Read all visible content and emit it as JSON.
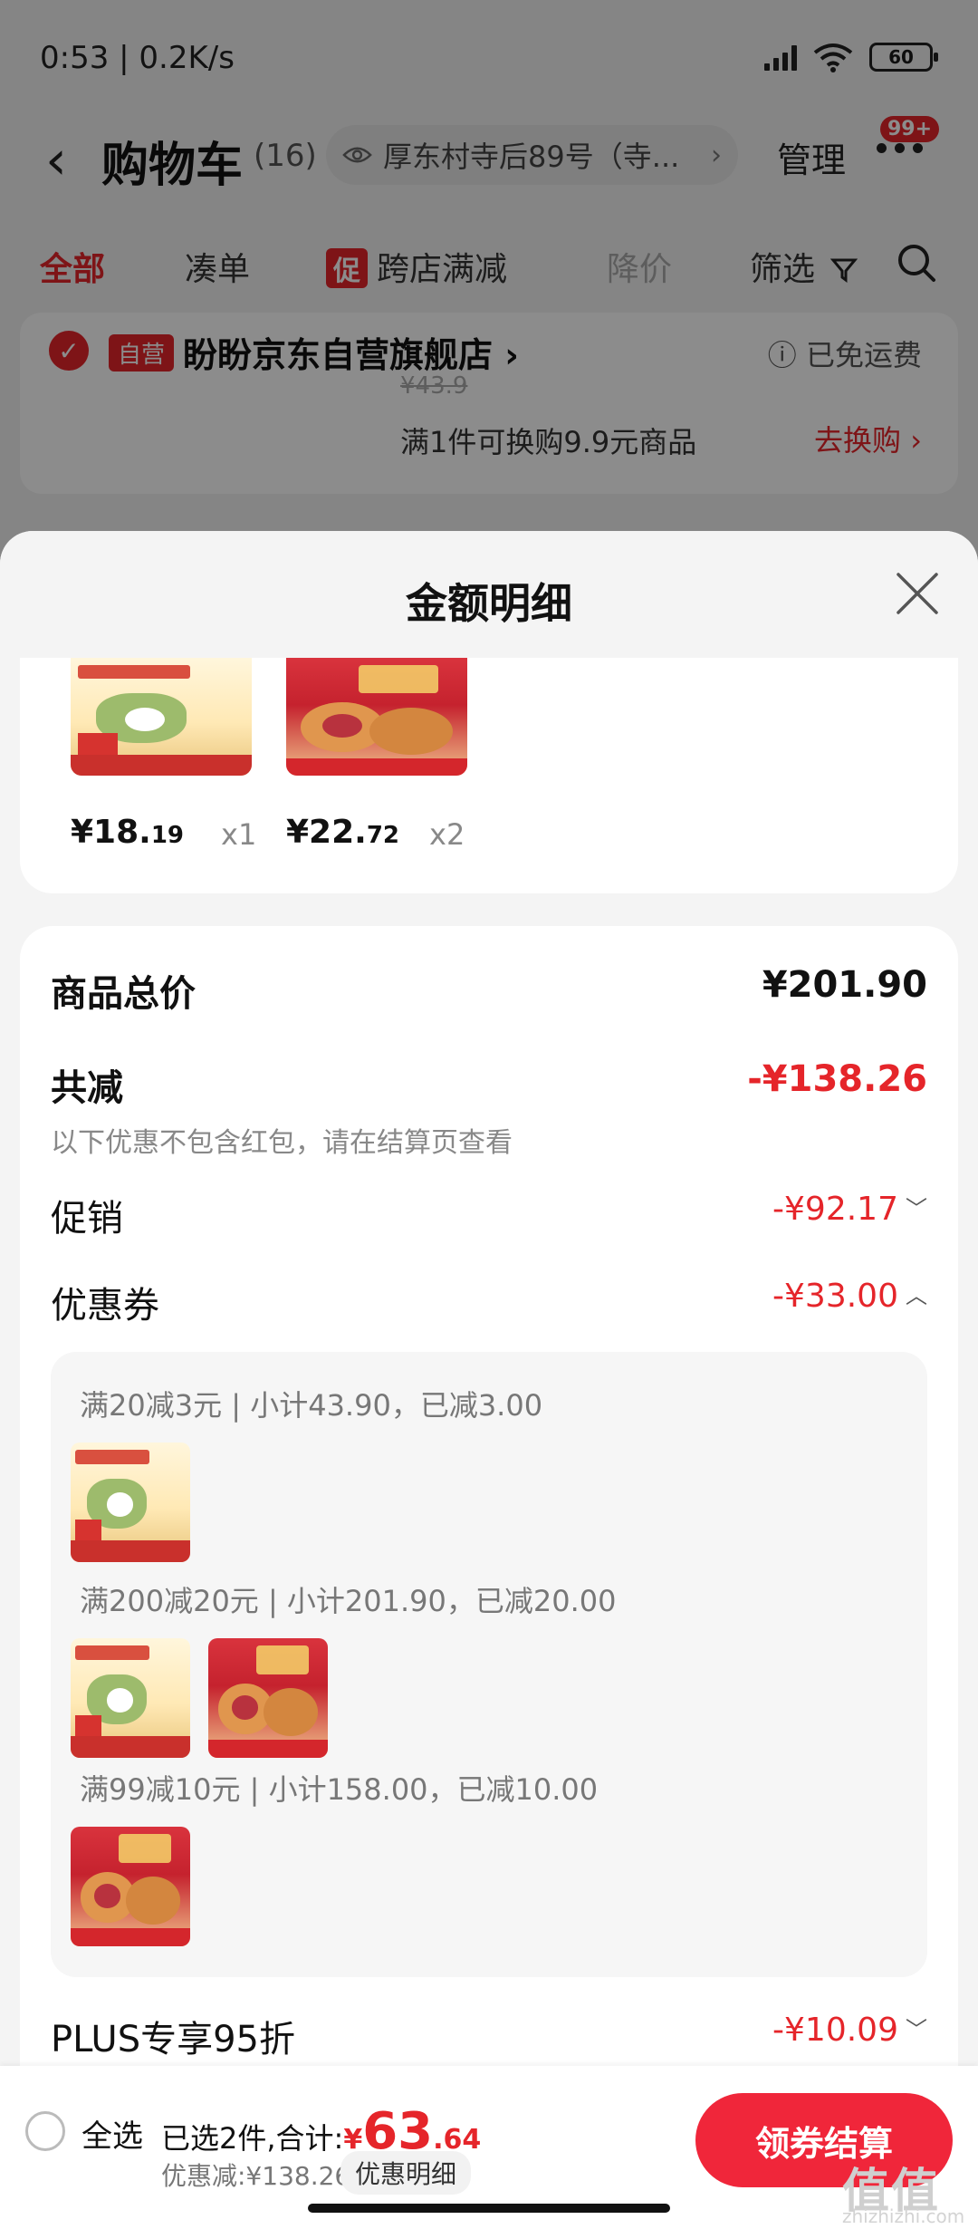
{
  "status_bar": {
    "time": "0:53 | 0.2K/s",
    "battery": "60"
  },
  "nav": {
    "back_icon": "chevron-left-icon",
    "title": "购物车",
    "count": "(16)",
    "address": "厚东村寺后89号（寺...",
    "manage": "管理",
    "badge": "99+"
  },
  "filter_tabs": [
    {
      "label": "全部",
      "state": "active"
    },
    {
      "label": "凑单",
      "state": "normal"
    },
    {
      "label": "跨店满减",
      "promo": "促",
      "state": "normal"
    },
    {
      "label": "降价",
      "state": "muted"
    },
    {
      "label": "筛选",
      "state": "normal"
    }
  ],
  "store": {
    "self_tag": "自营",
    "name": "盼盼京东自营旗舰店",
    "free_shipping": "已免运费",
    "old_price": "¥43.9",
    "swap_text": "满1件可换购9.9元商品",
    "swap_link": "去换购"
  },
  "sheet": {
    "title": "金额明细"
  },
  "products": [
    {
      "price_int": "¥18.",
      "price_dec": "19",
      "qty": "x1"
    },
    {
      "price_int": "¥22.",
      "price_dec": "72",
      "qty": "x2"
    }
  ],
  "summary": {
    "total_label": "商品总价",
    "total_value": "¥201.90",
    "reduce_label": "共减",
    "reduce_value": "-¥138.26",
    "reduce_note": "以下优惠不包含红包，请在结算页查看",
    "promo_label": "促销",
    "promo_value": "-¥92.17",
    "coupon_label": "优惠券",
    "coupon_value": "-¥33.00",
    "plus_label": "PLUS专享95折",
    "plus_value": "-¥10.09"
  },
  "coupons": [
    {
      "text": "满20减3元 | 小计43.90，已减3.00"
    },
    {
      "text": "满200减20元 | 小计201.90，已减20.00"
    },
    {
      "text": "满99减10元 | 小计158.00，已减10.00"
    }
  ],
  "bottom_bar": {
    "select_all": "全选",
    "selected_text": "已选2件,合计:",
    "total_yen": "¥",
    "total_big": "63",
    "total_dec": ".64",
    "discount_text": "优惠减:¥138.26",
    "detail_btn": "优惠明细",
    "checkout": "领券结算"
  },
  "watermark": {
    "main": "值值值",
    "sub": "zhizhizhi.com"
  },
  "colors": {
    "accent": "#e5252a",
    "checkout": "#f0263a"
  }
}
